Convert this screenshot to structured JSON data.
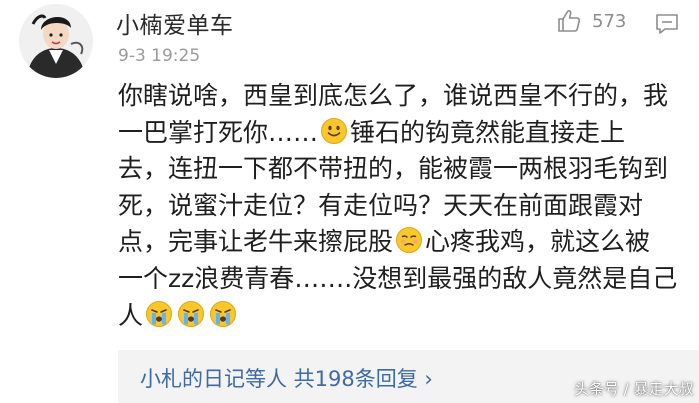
{
  "comment": {
    "username": "小楠爱单车",
    "timestamp": "9-3 19:25",
    "like_count": "573",
    "body_lines": [
      [
        "你瞎说啥，西皇到底怎么了，谁说西皇不行的，我"
      ],
      [
        "一巴掌打死你……",
        "锤石的钩竟然能直接走上"
      ],
      [
        "去，连扭一下都不带扭的，能被霞一两根羽毛钩到"
      ],
      [
        "死，说蜜汁走位？有走位吗？天天在前面跟霞对"
      ],
      [
        "点，完事让老牛来擦屁股",
        "心疼我鸡，就这么被"
      ],
      [
        "一个zz浪费青春…….没想到最强的敌人竟然是自己"
      ],
      [
        "人"
      ]
    ],
    "emojis": [
      "smile-emoji",
      "disappointed-emoji",
      "crying-emoji",
      "crying-emoji",
      "crying-emoji"
    ]
  },
  "replies": {
    "summary": "小札的日记等人  共198条回复 ›"
  },
  "watermark": "头条号 / 暴走大叔",
  "colors": {
    "link_blue": "#3d6aa3",
    "meta_gray": "#9a9a9a",
    "reply_bg": "#f3f3f3",
    "emoji_yellow": "#f8c72c"
  }
}
